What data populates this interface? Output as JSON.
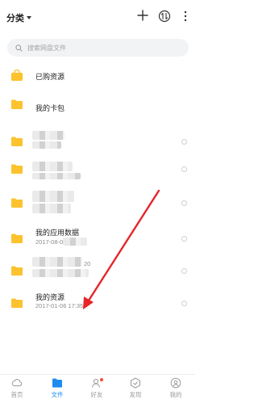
{
  "header": {
    "category_label": "分类"
  },
  "search": {
    "placeholder": "搜索网盘文件"
  },
  "files": [
    {
      "name": "已购资源",
      "date": ""
    },
    {
      "name": "我的卡包",
      "date": ""
    },
    {
      "name": "",
      "date": ""
    },
    {
      "name": "",
      "date": ""
    },
    {
      "name": "",
      "date": ""
    },
    {
      "name": "我的应用数据",
      "date": "2017-08-0"
    },
    {
      "name": "",
      "date": "20"
    },
    {
      "name": "我的资源",
      "date": "2017-01-06  17:35"
    }
  ],
  "nav": [
    {
      "label": "首页",
      "icon": "home-icon"
    },
    {
      "label": "文件",
      "icon": "folder-icon"
    },
    {
      "label": "好友",
      "icon": "friends-icon"
    },
    {
      "label": "发现",
      "icon": "discover-icon"
    },
    {
      "label": "我的",
      "icon": "profile-icon"
    }
  ],
  "colors": {
    "accent": "#1e8cf0",
    "folder": "#fcc32f",
    "badge": "#f34b3b",
    "annotation_arrow": "#e5252a"
  }
}
